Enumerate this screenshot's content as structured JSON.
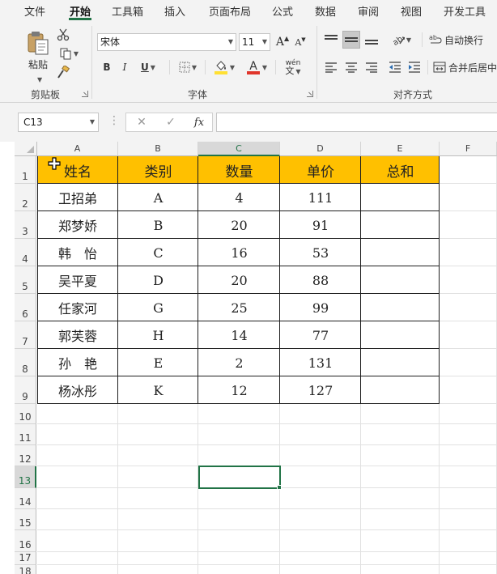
{
  "menu": {
    "tabs": [
      "文件",
      "开始",
      "工具箱",
      "插入",
      "页面布局",
      "公式",
      "数据",
      "审阅",
      "视图",
      "开发工具"
    ],
    "active": "开始"
  },
  "ribbon": {
    "clipboard": {
      "paste_label": "粘贴",
      "group_label": "剪贴板"
    },
    "font": {
      "font_name": "宋体",
      "font_size": "11",
      "grow_label": "A",
      "shrink_label": "A",
      "bold": "B",
      "italic": "I",
      "underline": "U",
      "font_color_letter": "A",
      "phonetic_label": "wén",
      "group_label": "字体",
      "fill_color": "#ffe033",
      "font_color": "#e0352b"
    },
    "alignment": {
      "wrap_label": "自动换行",
      "merge_label": "合并后居中",
      "group_label": "对齐方式"
    }
  },
  "formula_bar": {
    "name_box": "C13",
    "fx_label": "fx",
    "formula": ""
  },
  "sheet": {
    "columns": [
      "A",
      "B",
      "C",
      "D",
      "E",
      "F"
    ],
    "rows": [
      "1",
      "2",
      "3",
      "4",
      "5",
      "6",
      "7",
      "8",
      "9",
      "10",
      "11",
      "12",
      "13",
      "14",
      "15",
      "16",
      "17",
      "18"
    ],
    "selected_column": "C",
    "selected_row": "13",
    "table": {
      "headers": [
        "姓名",
        "类别",
        "数量",
        "单价",
        "总和"
      ],
      "header_fill": "#ffc000",
      "data": [
        [
          "卫招弟",
          "A",
          "4",
          "111",
          ""
        ],
        [
          "郑梦娇",
          "B",
          "20",
          "91",
          ""
        ],
        [
          "韩　怡",
          "C",
          "16",
          "53",
          ""
        ],
        [
          "吴平夏",
          "D",
          "20",
          "88",
          ""
        ],
        [
          "任家河",
          "G",
          "25",
          "99",
          ""
        ],
        [
          "郭芙蓉",
          "H",
          "14",
          "77",
          ""
        ],
        [
          "孙　艳",
          "E",
          "2",
          "131",
          ""
        ],
        [
          "杨冰彤",
          "K",
          "12",
          "127",
          ""
        ]
      ]
    },
    "accent": "#217346"
  }
}
